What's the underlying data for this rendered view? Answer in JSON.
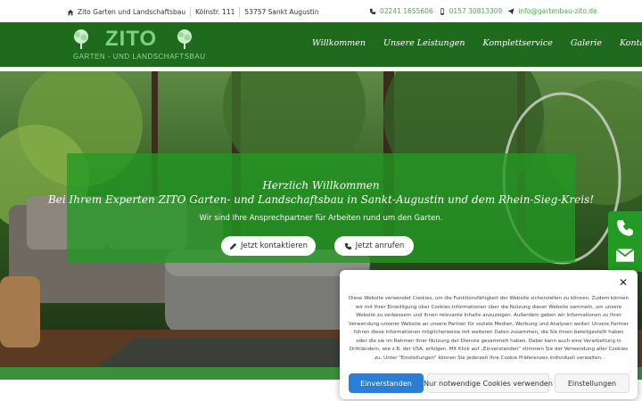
{
  "topbar": {
    "company": "Zito Garten und Landschaftsbau",
    "street": "Kölnstr. 111",
    "city": "53757 Sankt Augustin",
    "phone1": "02241 1655606",
    "phone2": "0157 30813309",
    "email": "info@gartenbau-zito.de"
  },
  "logo": {
    "name": "ZITO",
    "tagline": "GARTEN - UND LANDSCHAFTSBAU"
  },
  "nav": {
    "items": [
      "Willkommen",
      "Unsere Leistungen",
      "Komplettservice",
      "Galerie",
      "Kontakt"
    ]
  },
  "hero": {
    "title_line1": "Herzlich Willkommen",
    "title_line2": "Bei Ihrem Experten ZITO Garten- und Landschaftsbau in Sankt-Augustin und dem Rhein-Sieg-Kreis!",
    "subtitle": "Wir sind Ihre Ansprechpartner für Arbeiten rund um den Garten.",
    "button_contact": "Jetzt kontaktieren",
    "button_call": "Jetzt anrufen"
  },
  "cookie": {
    "text": "Diese Website verwendet Cookies, um die Funktionsfähigkeit der Website sicherstellen zu können. Zudem können wir mit Ihrer Einwilligung über Cookies Informationen über die Nutzung dieser Website sammeln, um unsere Website zu verbessern und Ihnen relevante Inhalte anzuzeigen. Außerdem geben wir Informationen zu Ihrer Verwendung unserer Website an unsere Partner für soziale Medien, Werbung und Analysen weiter. Unsere Partner führen diese Informationen möglicherweise mit weiteren Daten zusammen, die Sie ihnen bereitgestellt haben oder die sie im Rahmen Ihrer Nutzung der Dienste gesammelt haben. Dabei kann auch eine Verarbeitung in Drittländern, wie z.B. der USA, erfolgen. Mit Klick auf „Einverstanden“ stimmen Sie der Verwendung aller Cookies zu. Unter \"Einstellungen\" können Sie jederzeit Ihre Cookie Präferenzen individuell verwalten.",
    "accept": "Einverstanden",
    "necessary": "Nur notwendige Cookies verwenden",
    "settings": "Einstellungen",
    "close": "✕"
  },
  "colors": {
    "header_green": "#1e6b1e",
    "hero_overlay": "#229922",
    "accent_green": "#4caf50",
    "accept_blue": "#2a7ed6"
  }
}
